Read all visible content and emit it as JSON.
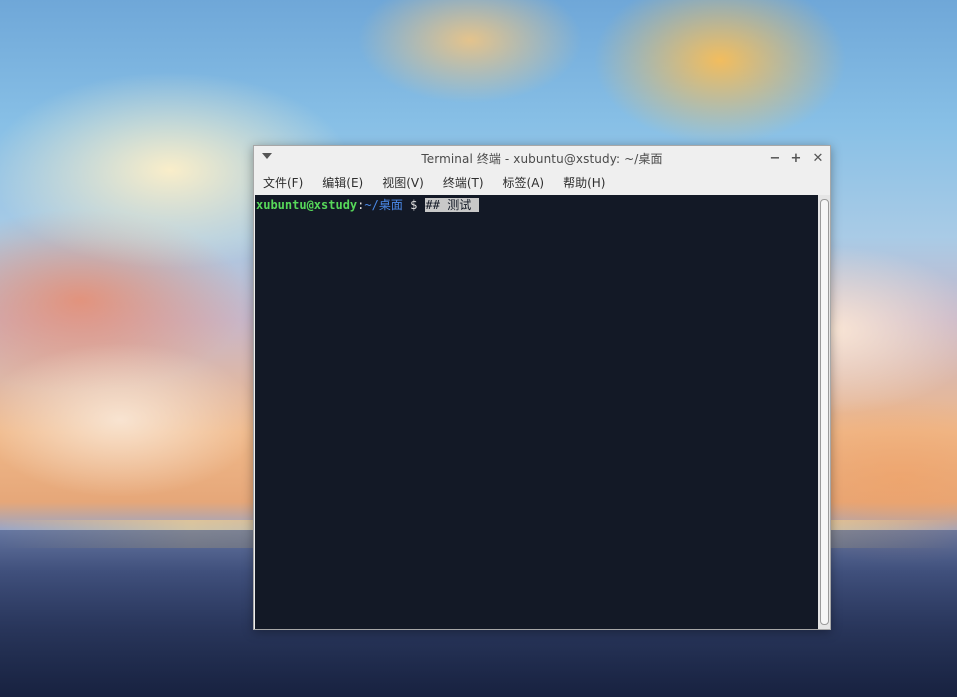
{
  "window": {
    "title": "Terminal 终端 - xubuntu@xstudy: ~/桌面",
    "controls": {
      "minimize": "−",
      "maximize": "+",
      "close": "✕"
    }
  },
  "menubar": {
    "items": [
      {
        "label": "文件(F)"
      },
      {
        "label": "编辑(E)"
      },
      {
        "label": "视图(V)"
      },
      {
        "label": "终端(T)"
      },
      {
        "label": "标签(A)"
      },
      {
        "label": "帮助(H)"
      }
    ]
  },
  "terminal": {
    "user_host": "xubuntu@xstudy",
    "colon": ":",
    "path": "~/桌面",
    "dollar": " $ ",
    "command": "## 测试 "
  },
  "colors": {
    "terminal_bg": "#131926",
    "prompt_user": "#57d85a",
    "prompt_path": "#4a89e8"
  },
  "icons": {
    "window_menu": "chevron-down-icon",
    "minimize": "minimize-icon",
    "maximize": "maximize-icon",
    "close": "close-icon"
  }
}
